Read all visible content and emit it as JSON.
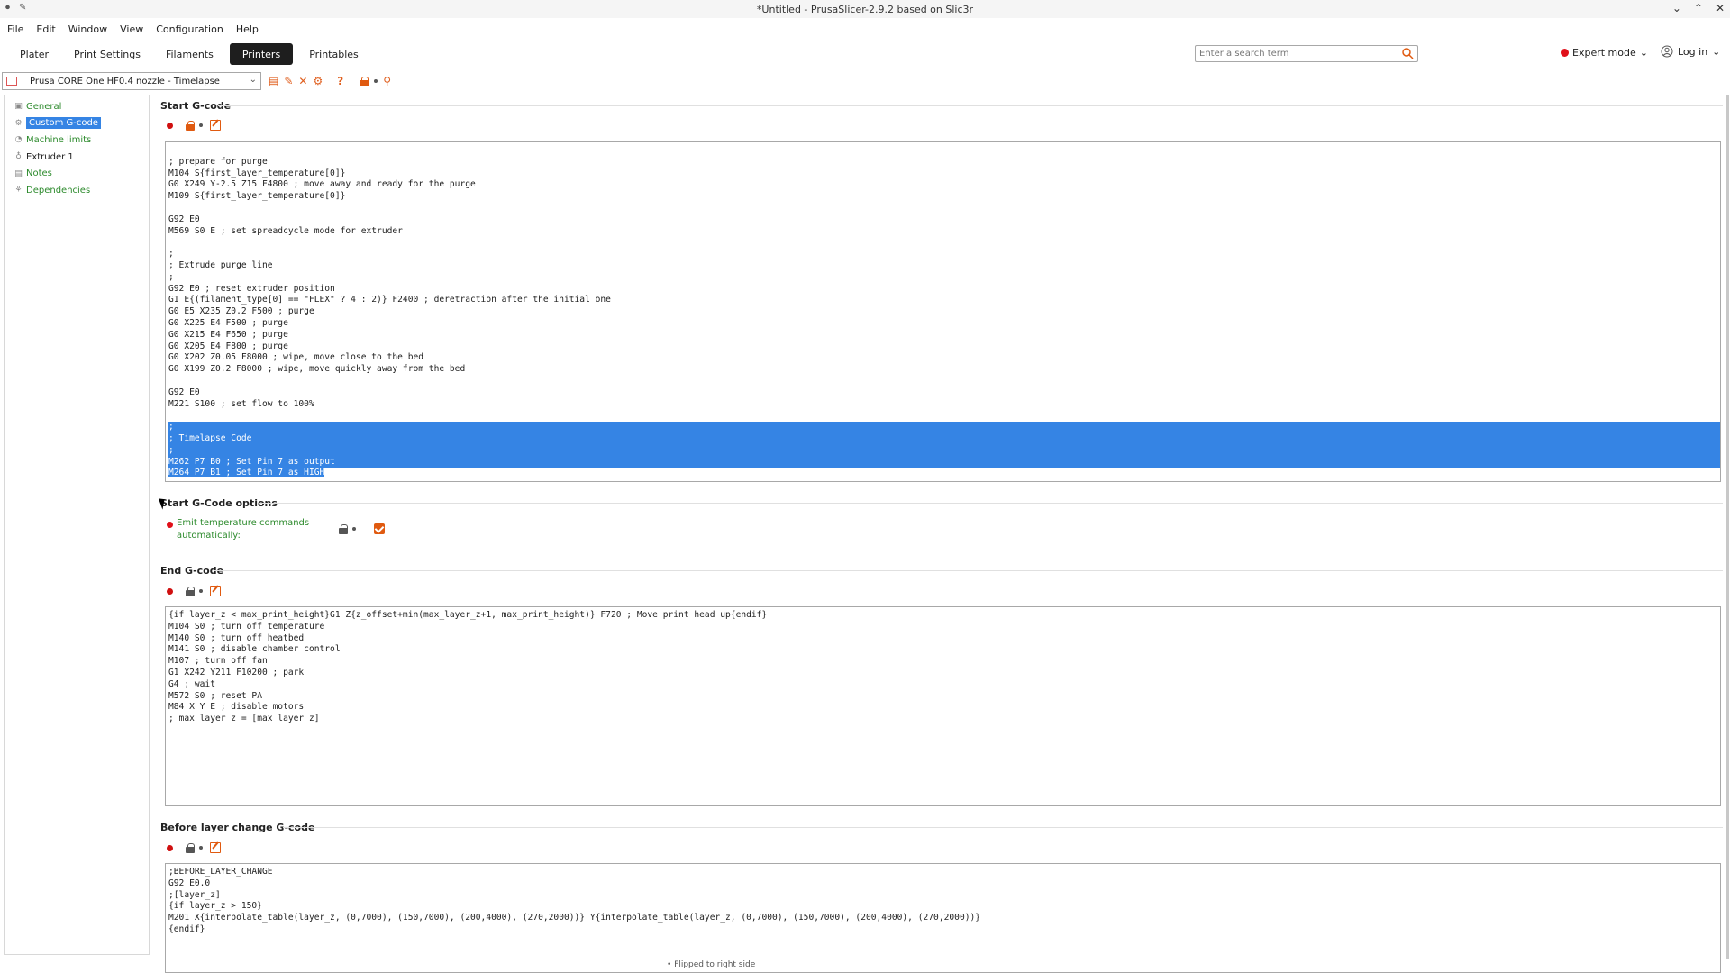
{
  "window": {
    "title": "*Untitled - PrusaSlicer-2.9.2 based on Slic3r"
  },
  "menu": [
    "File",
    "Edit",
    "Window",
    "View",
    "Configuration",
    "Help"
  ],
  "tabs": [
    "Plater",
    "Print Settings",
    "Filaments",
    "Printers",
    "Printables"
  ],
  "active_tab": "Printers",
  "search": {
    "placeholder": "Enter a search term"
  },
  "mode": {
    "label": "Expert mode",
    "color": "#e0101a"
  },
  "login": {
    "label": "Log in"
  },
  "preset": {
    "name": "Prusa CORE One HF0.4 nozzle - Timelapse"
  },
  "tree": {
    "items": [
      {
        "label": "General",
        "icon": "printer-icon"
      },
      {
        "label": "Custom G-code",
        "icon": "gcode-icon",
        "selected": true
      },
      {
        "label": "Machine limits",
        "icon": "gauge-icon"
      },
      {
        "label": "Extruder 1",
        "icon": "extruder-icon"
      },
      {
        "label": "Notes",
        "icon": "notes-icon"
      },
      {
        "label": "Dependencies",
        "icon": "dependencies-icon"
      }
    ]
  },
  "sections": {
    "start_gcode": {
      "title": "Start G-code",
      "lines": [
        "",
        "; prepare for purge",
        "M104 S{first_layer_temperature[0]}",
        "G0 X249 Y-2.5 Z15 F4800 ; move away and ready for the purge",
        "M109 S{first_layer_temperature[0]}",
        "",
        "G92 E0",
        "M569 S0 E ; set spreadcycle mode for extruder",
        "",
        ";",
        "; Extrude purge line",
        ";",
        "G92 E0 ; reset extruder position",
        "G1 E{(filament_type[0] == \"FLEX\" ? 4 : 2)} F2400 ; deretraction after the initial one",
        "G0 E5 X235 Z0.2 F500 ; purge",
        "G0 X225 E4 F500 ; purge",
        "G0 X215 E4 F650 ; purge",
        "G0 X205 E4 F800 ; purge",
        "G0 X202 Z0.05 F8000 ; wipe, move close to the bed",
        "G0 X199 Z0.2 F8000 ; wipe, move quickly away from the bed",
        "",
        "G92 E0",
        "M221 S100 ; set flow to 100%",
        "",
        ";",
        "; Timelapse Code",
        ";",
        "M262 P7 B0 ; Set Pin 7 as output",
        "M264 P7 B1 ; Set Pin 7 as HIGH"
      ]
    },
    "start_gcode_options": {
      "title": "Start G-Code options",
      "emit_label": "Emit temperature commands automatically:",
      "emit_checked": true
    },
    "end_gcode": {
      "title": "End G-code",
      "lines": [
        "{if layer_z < max_print_height}G1 Z{z_offset+min(max_layer_z+1, max_print_height)} F720 ; Move print head up{endif}",
        "M104 S0 ; turn off temperature",
        "M140 S0 ; turn off heatbed",
        "M141 S0 ; disable chamber control",
        "M107 ; turn off fan",
        "G1 X242 Y211 F10200 ; park",
        "G4 ; wait",
        "M572 S0 ; reset PA",
        "M84 X Y E ; disable motors",
        "; max_layer_z = [max_layer_z]"
      ]
    },
    "before_layer_gcode": {
      "title": "Before layer change G-code",
      "lines": [
        ";BEFORE_LAYER_CHANGE",
        "G92 E0.0",
        ";[layer_z]",
        "{if layer_z > 150}",
        "M201 X{interpolate_table(layer_z, (0,7000), (150,7000), (200,4000), (270,2000))} Y{interpolate_table(layer_z, (0,7000), (150,7000), (200,4000), (270,2000))}",
        "{endif}"
      ]
    }
  },
  "status_hint": "• Flipped to right side",
  "colors": {
    "accent": "#e05a10",
    "selection": "#3584e4",
    "tree_text": "#2c8a2c"
  }
}
